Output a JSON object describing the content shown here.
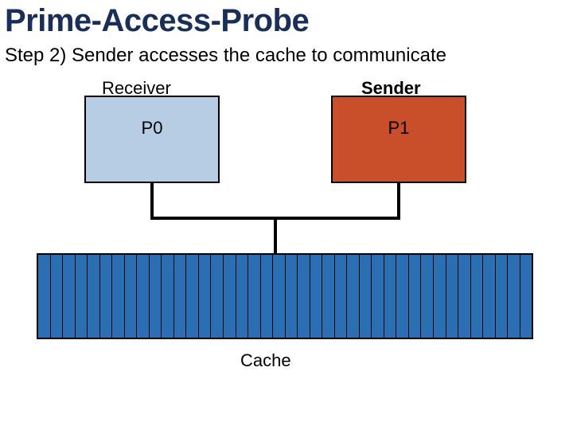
{
  "title": "Prime-Access-Probe",
  "subtitle": "Step 2) Sender accesses the cache to communicate",
  "roles": {
    "receiver": "Receiver",
    "sender": "Sender"
  },
  "processors": {
    "p0": "P0",
    "p1": "P1"
  },
  "cache": {
    "label": "Cache",
    "slot_count": 40
  },
  "colors": {
    "title": "#1a2e5a",
    "p0_fill": "#b6cde4",
    "p1_fill": "#c94f2a",
    "cache_fill": "#2a6fb3"
  }
}
